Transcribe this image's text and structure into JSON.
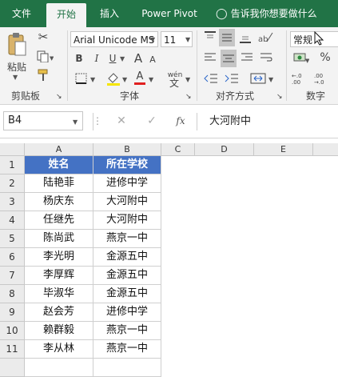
{
  "tabs": {
    "file": "文件",
    "home": "开始",
    "insert": "插入",
    "power_pivot": "Power Pivot",
    "tell_me": "告诉我你想要做什么"
  },
  "ribbon": {
    "clipboard": {
      "paste": "粘贴",
      "label": "剪贴板"
    },
    "font": {
      "name": "Arial Unicode MS",
      "size": "11",
      "bold": "B",
      "italic": "I",
      "underline": "U",
      "font_color": "A",
      "phonetic": "wén",
      "label": "字体"
    },
    "alignment": {
      "label": "对齐方式"
    },
    "number": {
      "format": "常规",
      "percent": "%",
      "label": "数字"
    }
  },
  "formula_bar": {
    "name_box": "B4",
    "fx": "fx",
    "content": "大河附中"
  },
  "sheet": {
    "columns": [
      "A",
      "B",
      "C",
      "D",
      "E"
    ],
    "rows": [
      {
        "num": "1",
        "a": "姓名",
        "b": "所在学校"
      },
      {
        "num": "2",
        "a": "陆艳菲",
        "b": "进修中学"
      },
      {
        "num": "3",
        "a": "杨庆东",
        "b": "大河附中"
      },
      {
        "num": "4",
        "a": "任继先",
        "b": "大河附中"
      },
      {
        "num": "5",
        "a": "陈尚武",
        "b": "燕京一中"
      },
      {
        "num": "6",
        "a": "李光明",
        "b": "金源五中"
      },
      {
        "num": "7",
        "a": "李厚辉",
        "b": "金源五中"
      },
      {
        "num": "8",
        "a": "毕淑华",
        "b": "金源五中"
      },
      {
        "num": "9",
        "a": "赵会芳",
        "b": "进修中学"
      },
      {
        "num": "10",
        "a": "赖群毅",
        "b": "燕京一中"
      },
      {
        "num": "11",
        "a": "李从林",
        "b": "燕京一中"
      }
    ]
  },
  "colors": {
    "accent": "#217346",
    "header_fill": "#4472c4"
  }
}
